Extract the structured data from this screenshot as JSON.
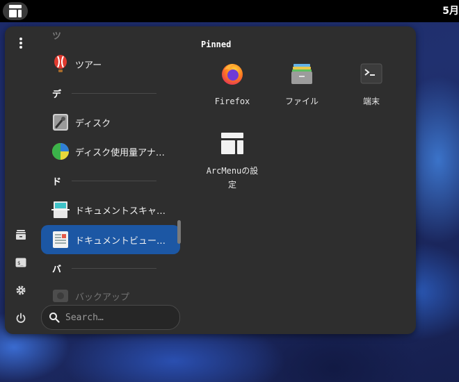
{
  "topbar": {
    "clock": "5月"
  },
  "rail": {
    "kebab": "more-icon",
    "items": [
      {
        "name": "files-icon"
      },
      {
        "name": "terminal-icon"
      },
      {
        "name": "settings-icon"
      },
      {
        "name": "power-icon"
      }
    ]
  },
  "apps": {
    "partial_top_letter": "ツ",
    "items": [
      {
        "label": "ツアー",
        "icon": "tour-balloon-icon"
      },
      {
        "section": "デ"
      },
      {
        "label": "ディスク",
        "icon": "disk-icon"
      },
      {
        "label": "ディスク使用量アナ…",
        "icon": "disk-usage-icon"
      },
      {
        "section": "ド"
      },
      {
        "label": "ドキュメントスキャ…",
        "icon": "scanner-icon"
      },
      {
        "label": "ドキュメントビュー…",
        "icon": "document-viewer-icon",
        "selected": true
      },
      {
        "section": "バ"
      },
      {
        "label": "バックアップ",
        "icon": "backup-icon"
      }
    ]
  },
  "search": {
    "placeholder": "Search…"
  },
  "pinned": {
    "title": "Pinned",
    "apps": [
      {
        "label": "Firefox",
        "icon": "firefox-icon"
      },
      {
        "label": "ファイル",
        "icon": "files-icon"
      },
      {
        "label": "端末",
        "icon": "terminal-icon"
      },
      {
        "label": "ArcMenuの設\n定",
        "label_line1": "ArcMenuの設",
        "label_line2": "定",
        "icon": "arcmenu-settings-icon"
      }
    ]
  },
  "colors": {
    "accent": "#1c57a4",
    "menu_bg": "#2e2e2e",
    "topbar_bg": "#000000"
  }
}
